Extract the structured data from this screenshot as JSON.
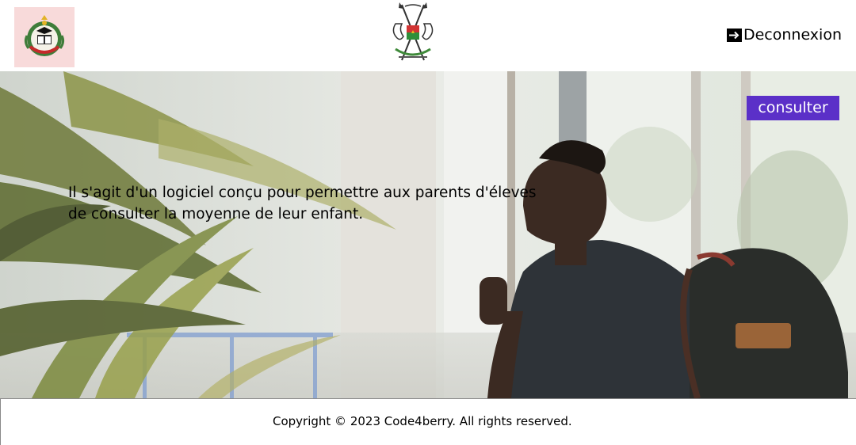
{
  "header": {
    "school_logo_icon": "school-crest-icon",
    "emblem_icon": "burkina-faso-coat-of-arms-icon",
    "logout_icon": "logout-arrow-icon",
    "logout_label": "Deconnexion"
  },
  "hero": {
    "consult_label": "consulter",
    "description": "Il s'agit d'un logiciel conçu pour permettre aux parents d'éleves de consulter la moyenne de leur enfant."
  },
  "footer": {
    "copyright": "Copyright © 2023 Code4berry. All rights reserved."
  },
  "colors": {
    "accent": "#5b30c8",
    "school_logo_bg": "#f8dada"
  }
}
